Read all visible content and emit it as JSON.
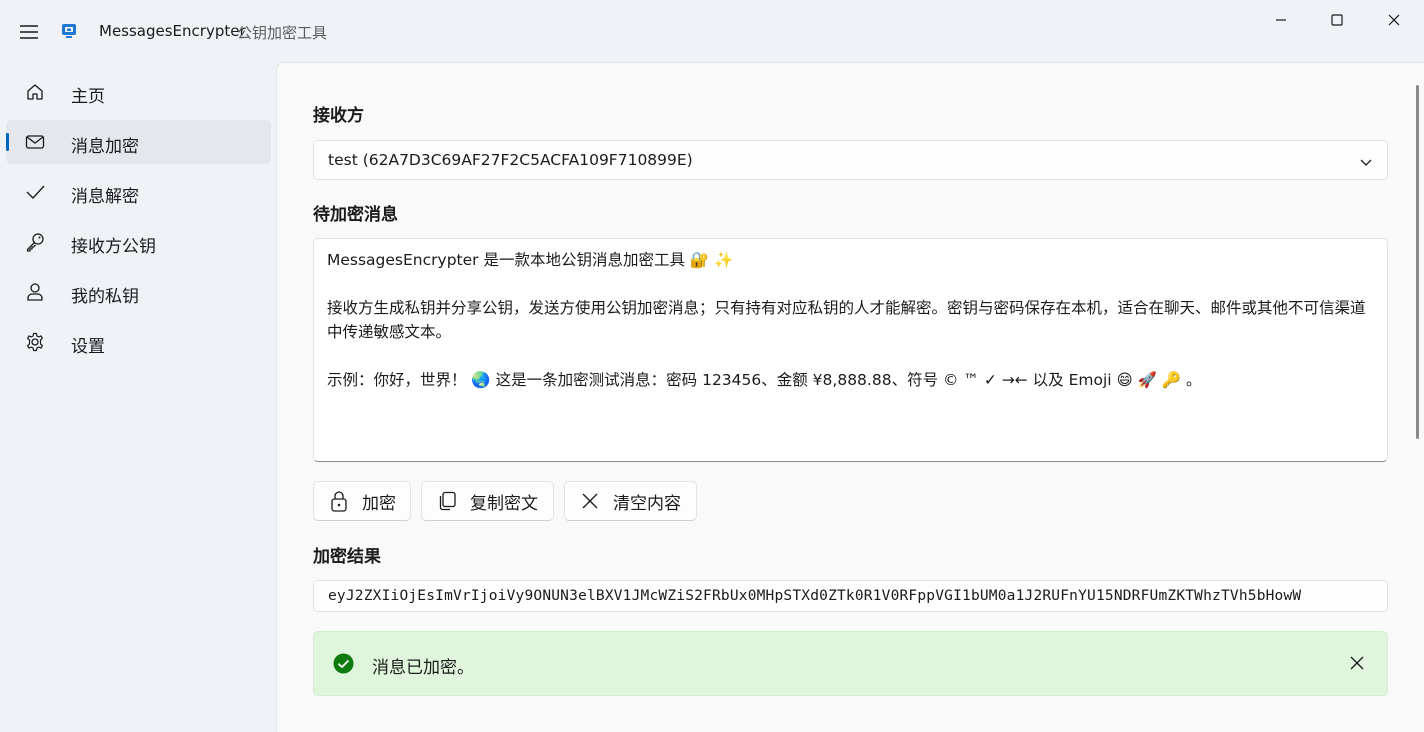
{
  "titlebar": {
    "app_name": "MessagesEncrypter",
    "subtitle": "公钥加密工具"
  },
  "sidebar": {
    "items": [
      {
        "label": "主页",
        "icon": "home-icon"
      },
      {
        "label": "消息加密",
        "icon": "mail-icon",
        "selected": true
      },
      {
        "label": "消息解密",
        "icon": "checkmark-icon"
      },
      {
        "label": "接收方公钥",
        "icon": "key-icon"
      },
      {
        "label": "我的私钥",
        "icon": "person-icon"
      },
      {
        "label": "设置",
        "icon": "gear-icon"
      }
    ]
  },
  "main": {
    "recipient_label": "接收方",
    "recipient_selected": "test (62A7D3C69AF27F2C5ACFA109F710899E)",
    "message_label": "待加密消息",
    "message_text": "MessagesEncrypter 是一款本地公钥消息加密工具 🔐 ✨\n\n接收方生成私钥并分享公钥，发送方使用公钥加密消息；只有持有对应私钥的人才能解密。密钥与密码保存在本机，适合在聊天、邮件或其他不可信渠道中传递敏感文本。\n\n示例：你好，世界！ 🌏 这是一条加密测试消息：密码 123456、金额 ¥8,888.88、符号 © ™ ✓ →← 以及 Emoji 😄 🚀 🔑 。",
    "buttons": {
      "encrypt": "加密",
      "copy": "复制密文",
      "clear": "清空内容"
    },
    "result_label": "加密结果",
    "result_text": "eyJ2ZXIiOjEsImVrIjoiVy9ONUN3elBXV1JMcWZiS2FRbUx0MHpSTXd0ZTk0R1V0RFppVGI1bUM0a1J2RUFnYU15NDRFUmZKTWhzTVh5bHowW",
    "info_message": "消息已加密。"
  },
  "colors": {
    "accent": "#0067c0",
    "success_bg": "#dff6dd",
    "success_icon": "#0f7b0f"
  }
}
